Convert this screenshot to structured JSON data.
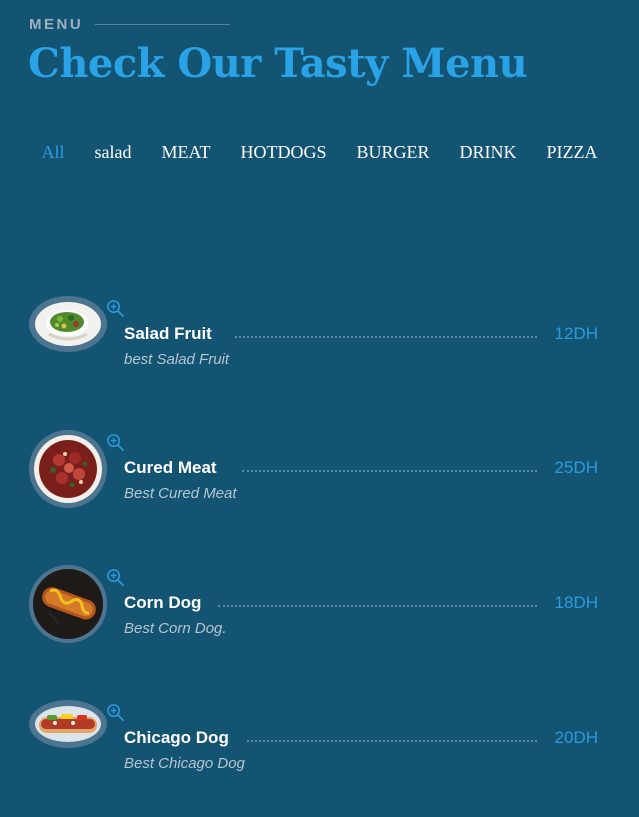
{
  "header": {
    "section_label": "MENU",
    "title": "Check Our Tasty Menu"
  },
  "filters": [
    {
      "label": "All",
      "active": true
    },
    {
      "label": "salad",
      "active": false
    },
    {
      "label": "MEAT",
      "active": false
    },
    {
      "label": "HOTDOGS",
      "active": false
    },
    {
      "label": "BURGER",
      "active": false
    },
    {
      "label": "DRINK",
      "active": false
    },
    {
      "label": "PIZZA",
      "active": false
    }
  ],
  "menu_items": [
    {
      "name": "Salad Fruit",
      "description": "best Salad Fruit",
      "price": "12DH",
      "image": "salad-bowl-photo",
      "zoom_icon": "zoom-in-icon"
    },
    {
      "name": "Cured Meat",
      "description": "Best Cured Meat",
      "price": "25DH",
      "image": "cured-meat-plate-photo",
      "zoom_icon": "zoom-in-icon"
    },
    {
      "name": "Corn Dog",
      "description": "Best Corn Dog.",
      "price": "18DH",
      "image": "corn-dog-photo",
      "zoom_icon": "zoom-in-icon"
    },
    {
      "name": "Chicago Dog",
      "description": "Best Chicago Dog",
      "price": "20DH",
      "image": "chicago-dog-photo",
      "zoom_icon": "zoom-in-icon"
    }
  ],
  "colors": {
    "background": "#135473",
    "accent": "#2b9be0",
    "title": "#2aa2e6",
    "text": "#ffffff",
    "muted_text": "#b6c6d1"
  }
}
